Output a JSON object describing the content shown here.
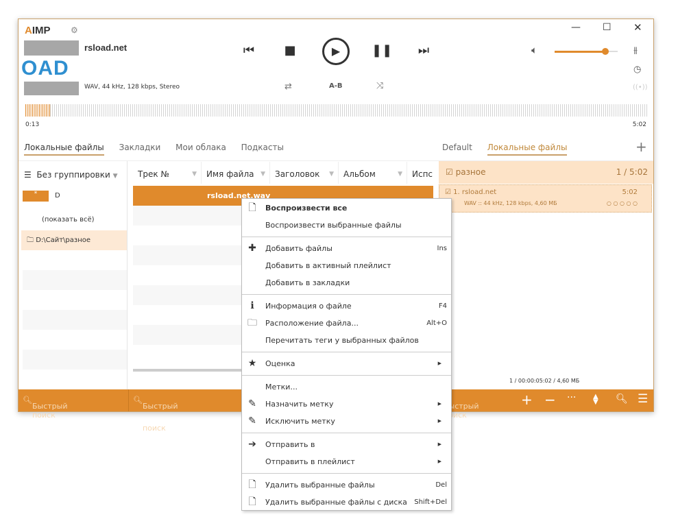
{
  "app": {
    "logo": "IMP",
    "logo_mark": "A"
  },
  "player": {
    "title": "rsload.net",
    "cover_text": "OAD",
    "info": "WAV, 44 kHz, 128 kbps, Stereo",
    "elapsed": "0:13",
    "total": "5:02",
    "ab_label": "A-B",
    "volume_percent": 80,
    "progress_percent": 4
  },
  "library_tabs": [
    "Локальные файлы",
    "Закладки",
    "Мои облака",
    "Подкасты"
  ],
  "playlist_tabs": [
    "Default",
    "Локальные файлы"
  ],
  "left_panel": {
    "grouping": "Без группировки",
    "drive": "D",
    "drive_badge": "*",
    "show_all": "(показать всё)",
    "folder": "D:\\Сайт\\разное"
  },
  "columns": [
    "Трек №",
    "Имя файла",
    "Заголовок",
    "Альбом",
    "Испс"
  ],
  "file_row": {
    "name": "rsload.net.wav"
  },
  "playlist": {
    "group": "разное",
    "group_info": "1 / 5:02",
    "track": "1. rsload.net",
    "track_time": "5:02",
    "track_info": "WAV :: 44 kHz, 128 kbps, 4,60 МБ",
    "rating": "○ ○ ○ ○ ○",
    "summary": "1 / 00:00:05:02 / 4,60 МБ"
  },
  "footer": {
    "search1": "Быстрый поиск",
    "search2": "Быстрый поиск",
    "search3": "Быстрый поиск"
  },
  "menu": [
    {
      "label": "Воспроизвести все",
      "key": "",
      "icon": "play-file-icon",
      "bold": true
    },
    {
      "label": "Воспроизвести выбранные файлы",
      "key": ""
    },
    {
      "sep": true
    },
    {
      "label": "Добавить файлы",
      "key": "Ins",
      "icon": "plus-icon"
    },
    {
      "label": "Добавить в активный плейлист",
      "key": ""
    },
    {
      "label": "Добавить в закладки",
      "key": ""
    },
    {
      "sep": true
    },
    {
      "label": "Информация о файле",
      "key": "F4",
      "icon": "info-icon"
    },
    {
      "label": "Расположение файла...",
      "key": "Alt+O",
      "icon": "folder-icon"
    },
    {
      "label": "Перечитать теги у выбранных файлов",
      "key": ""
    },
    {
      "sep": true
    },
    {
      "label": "Оценка",
      "key": "",
      "icon": "star-icon",
      "sub": true
    },
    {
      "sep": true
    },
    {
      "label": "Метки...",
      "key": ""
    },
    {
      "label": "Назначить метку",
      "key": "",
      "icon": "tag-icon",
      "sub": true
    },
    {
      "label": "Исключить метку",
      "key": "",
      "icon": "tag-remove-icon",
      "sub": true
    },
    {
      "sep": true
    },
    {
      "label": "Отправить в",
      "key": "",
      "icon": "arrow-right-icon",
      "sub": true
    },
    {
      "label": "Отправить в плейлист",
      "key": "",
      "sub": true
    },
    {
      "sep": true
    },
    {
      "label": "Удалить выбранные файлы",
      "key": "Del",
      "icon": "delete-icon"
    },
    {
      "label": "Удалить выбранные файлы с диска",
      "key": "Shift+Del",
      "icon": "delete-disk-icon"
    }
  ]
}
